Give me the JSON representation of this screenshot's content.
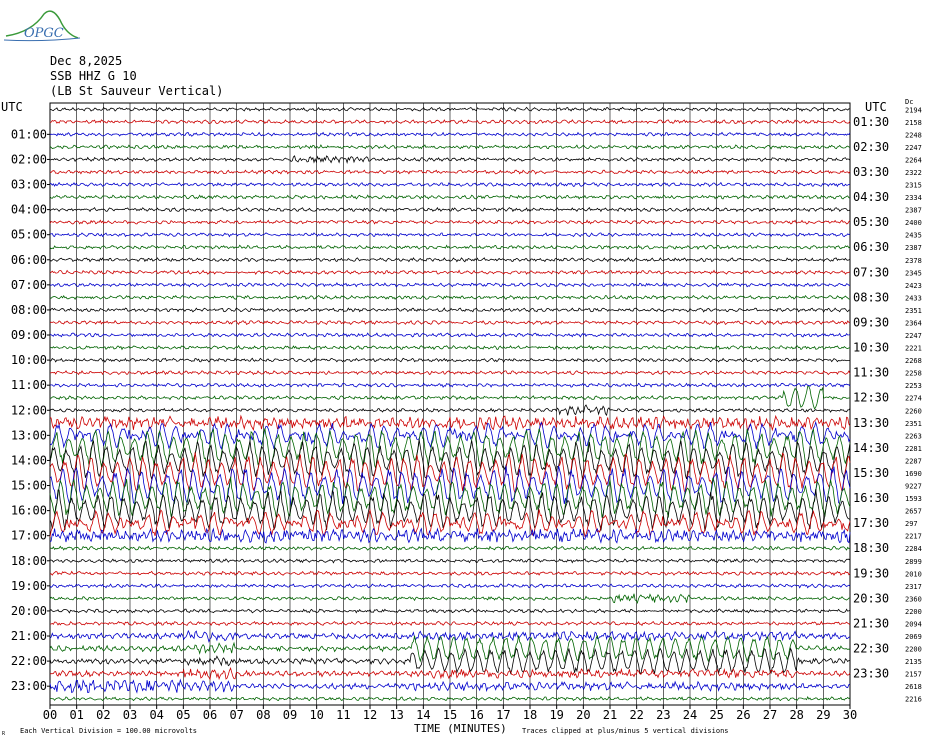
{
  "logo": {
    "text": "OPGC"
  },
  "header": {
    "date": "Dec 8,2025",
    "station": "SSB HHZ G 10",
    "site": "(LB St Sauveur Vertical)"
  },
  "utc_left_label": "UTC",
  "utc_right_label": "UTC",
  "scale_unit_label": "Dc",
  "footer": {
    "division": "Each Vertical Division =  100.00 microvolts",
    "xlabel": "TIME (MINUTES)",
    "clip_note": "Traces clipped at plus/minus 5 vertical divisions",
    "corner_mark": "R"
  },
  "chart_data": {
    "type": "line",
    "title": "Dec 8,2025 SSB HHZ G 10 (LB St Sauveur Vertical)",
    "xlabel": "TIME (MINUTES)",
    "xlim": [
      0,
      30
    ],
    "x_ticks": [
      "00",
      "01",
      "02",
      "03",
      "04",
      "05",
      "06",
      "07",
      "08",
      "09",
      "10",
      "11",
      "12",
      "13",
      "14",
      "15",
      "16",
      "17",
      "18",
      "19",
      "20",
      "21",
      "22",
      "23",
      "24",
      "25",
      "26",
      "27",
      "28",
      "29",
      "30"
    ],
    "row_minutes": 30,
    "trace_colors": [
      "#000000",
      "#cc0000",
      "#0000cc",
      "#006400"
    ],
    "left_hour_labels": [
      "01:00",
      "02:00",
      "03:00",
      "04:00",
      "05:00",
      "06:00",
      "07:00",
      "08:00",
      "09:00",
      "10:00",
      "11:00",
      "12:00",
      "13:00",
      "14:00",
      "15:00",
      "16:00",
      "17:00",
      "18:00",
      "19:00",
      "20:00",
      "21:00",
      "22:00",
      "23:00"
    ],
    "right_hour_labels": [
      "01:30",
      "02:30",
      "03:30",
      "04:30",
      "05:30",
      "06:30",
      "07:30",
      "08:30",
      "09:30",
      "10:30",
      "11:30",
      "12:30",
      "13:30",
      "14:30",
      "15:30",
      "16:30",
      "17:30",
      "18:30",
      "19:30",
      "20:30",
      "21:30",
      "22:30",
      "23:30"
    ],
    "dc_offsets": [
      2194,
      2158,
      2248,
      2247,
      2264,
      2322,
      2315,
      2334,
      2387,
      2400,
      2435,
      2387,
      2378,
      2345,
      2423,
      2433,
      2351,
      2364,
      2247,
      2221,
      2268,
      2258,
      2253,
      2274,
      2260,
      2351,
      2263,
      2281,
      2287,
      1690,
      9227,
      1593,
      2657,
      297,
      2217,
      2284,
      2899,
      2010,
      2317,
      2360,
      2200,
      2094,
      2069,
      2200,
      2135,
      2157,
      2618,
      2216
    ],
    "trace_activity": [
      1,
      1,
      1,
      1,
      1,
      1,
      1,
      1,
      1,
      1,
      1,
      1,
      1,
      1,
      1,
      1,
      1,
      1,
      1,
      1,
      1,
      1,
      1,
      1,
      1,
      1,
      1,
      1,
      1,
      1,
      1,
      1,
      1,
      1,
      1,
      1,
      1,
      1,
      1,
      1,
      1,
      1,
      1,
      1,
      1,
      1,
      1,
      1
    ],
    "clip_divisions": 5
  }
}
